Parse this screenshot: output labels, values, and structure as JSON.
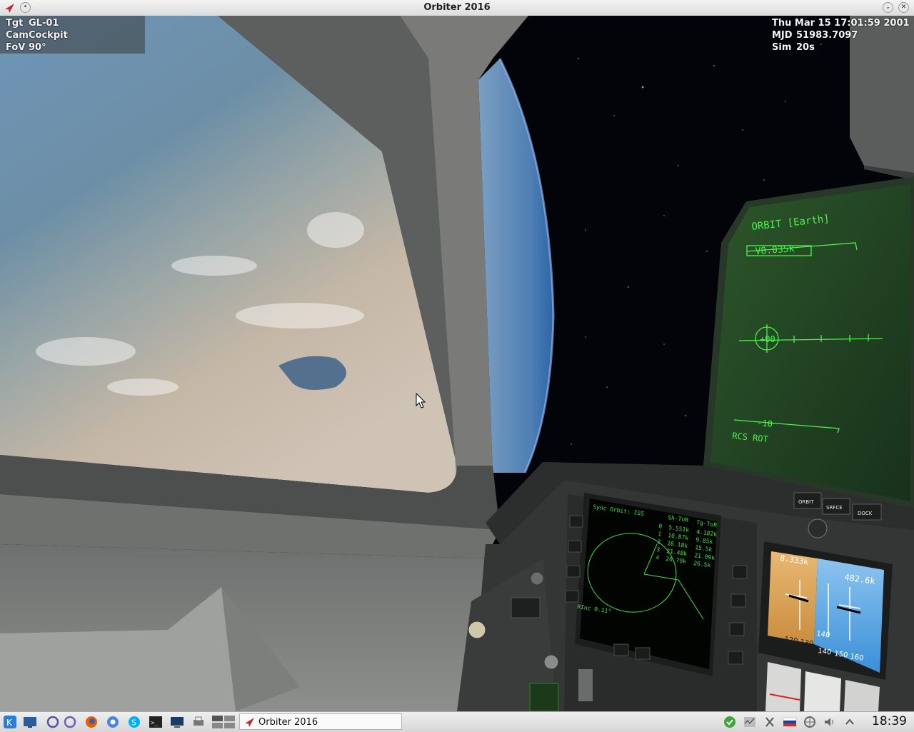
{
  "window": {
    "title": "Orbiter 2016"
  },
  "hud": {
    "target_label": "Tgt",
    "target_value": "GL-01",
    "cam_label": "Cam",
    "cam_value": "Cockpit",
    "fov_label": "FoV",
    "fov_value": "90°",
    "date": "Thu Mar 15 17:01:59 2001",
    "mjd_label": "MJD",
    "mjd_value": "51983.7097",
    "sim_label": "Sim",
    "sim_value": "20s"
  },
  "hud_panel": {
    "mode_title": "ORBIT [Earth]",
    "velocity_readout": "V8.035k",
    "center_readout": "+00",
    "pitch_readout": "-10",
    "rcs_label": "RCS ROT"
  },
  "mode_buttons": {
    "orbit": "ORBIT",
    "surface": "SRFCE",
    "dock": "DOCK"
  },
  "mfd": {
    "header": "Sync Orbit: ISS",
    "sync_label": "Sh-ToR",
    "col2_header": "Tg-ToR",
    "rows": [
      {
        "a": "0",
        "b": "5.551k",
        "c": "4.182k"
      },
      {
        "a": "1",
        "b": "10.87k",
        "c": "9.85k"
      },
      {
        "a": "2",
        "b": "16.18k",
        "c": "15.5k"
      },
      {
        "a": "3",
        "b": "21.48k",
        "c": "21.09k"
      },
      {
        "a": "4",
        "b": "26.79k",
        "c": "26.5k"
      }
    ],
    "rinc": "RInc  0.11°"
  },
  "adi": {
    "left_value": "8.333k",
    "right_value": "482.6k",
    "scale_left": [
      "120",
      "130"
    ],
    "scale_right": [
      "140",
      "150",
      "160"
    ],
    "center_scale": "140"
  },
  "taskbar": {
    "task_label": "Orbiter 2016",
    "clock": "18:39",
    "icons": [
      "kde-menu-icon",
      "desktop-icon",
      "refresh-icon",
      "refresh-alt-icon",
      "firefox-icon",
      "chromium-icon",
      "skype-icon",
      "terminal-icon",
      "monitor-icon",
      "printer-icon",
      "pager-icon"
    ]
  },
  "colors": {
    "mfd_green": "#3fe03f",
    "hud_green": "#4ff04f",
    "earth_blue": "#5f86a8",
    "panel_gray": "#6b6d6d"
  }
}
